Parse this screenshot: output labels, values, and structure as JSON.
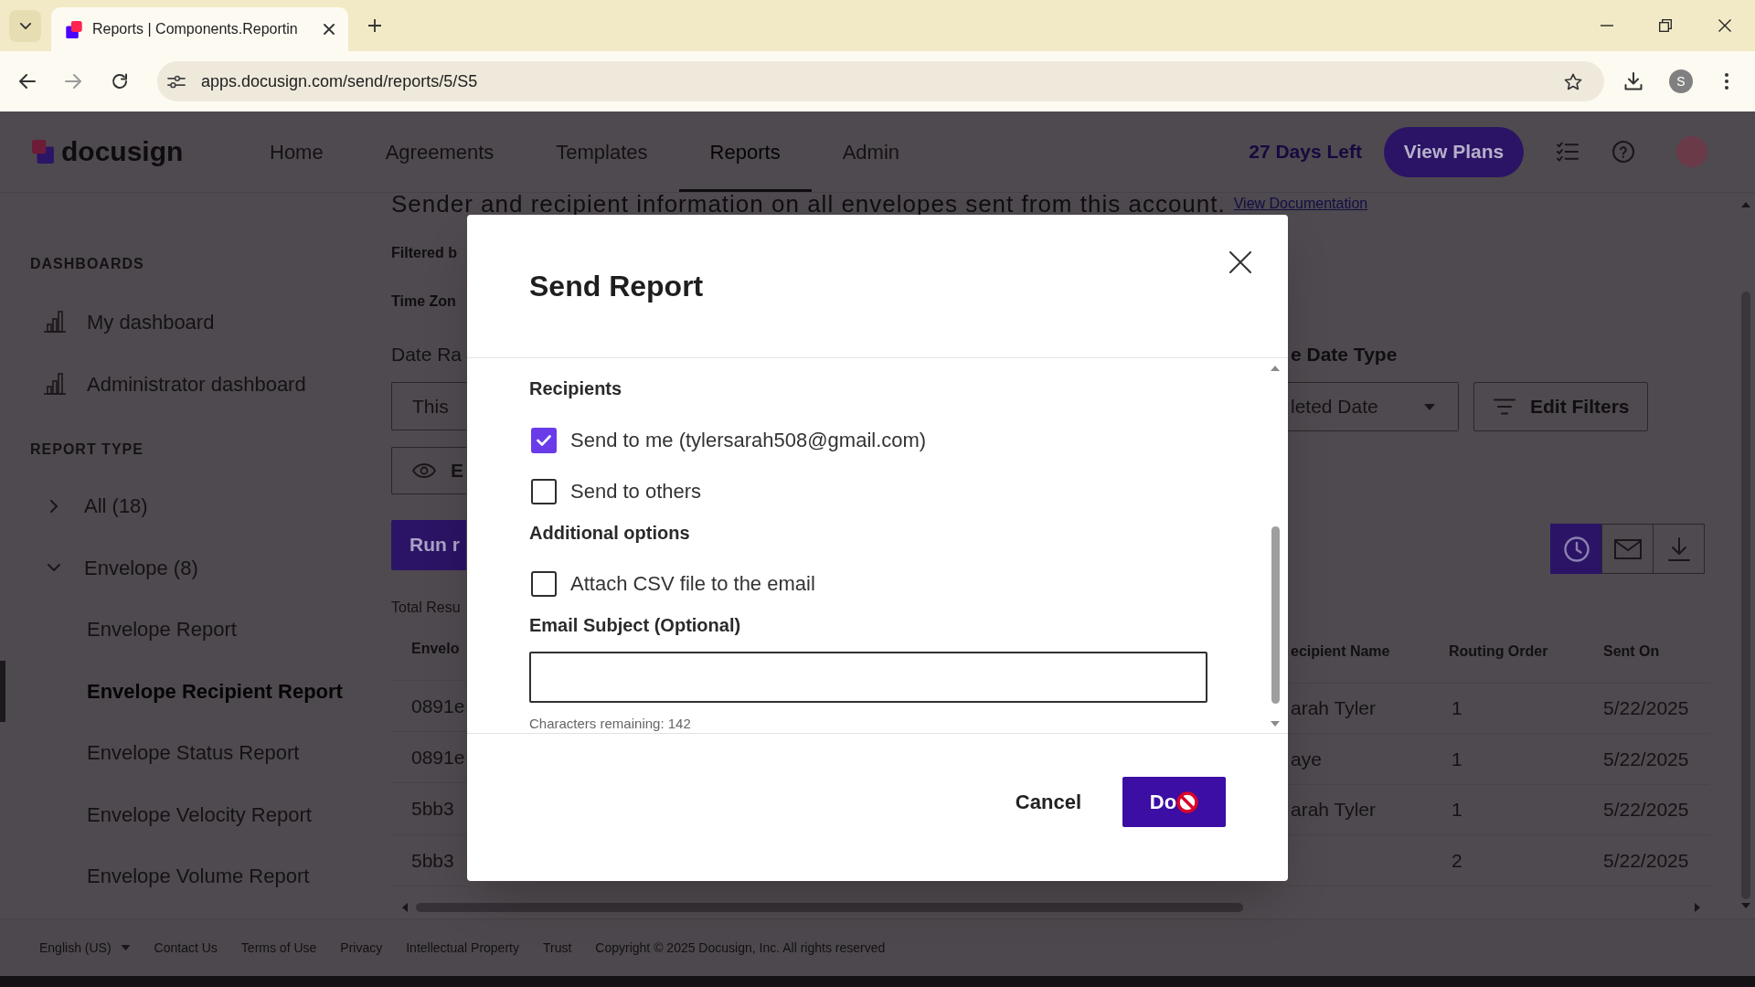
{
  "browser": {
    "tab_title": "Reports | Components.Reportin",
    "url": "apps.docusign.com/send/reports/5/S5",
    "profile_initial": "S"
  },
  "header": {
    "logo": "docusign",
    "nav": [
      {
        "label": "Home",
        "selected": false
      },
      {
        "label": "Agreements",
        "selected": false
      },
      {
        "label": "Templates",
        "selected": false
      },
      {
        "label": "Reports",
        "selected": true
      },
      {
        "label": "Admin",
        "selected": false
      }
    ],
    "trial": "27 Days Left",
    "cta": "View Plans"
  },
  "sidebar": {
    "dashboards_heading": "DASHBOARDS",
    "dashboards": [
      {
        "label": "My dashboard"
      },
      {
        "label": "Administrator dashboard"
      }
    ],
    "report_type_heading": "REPORT TYPE",
    "report_groups": [
      {
        "label": "All (18)",
        "expanded": false
      },
      {
        "label": "Envelope (8)",
        "expanded": true,
        "children": [
          {
            "label": "Envelope Report",
            "selected": false
          },
          {
            "label": "Envelope Recipient Report",
            "selected": true
          },
          {
            "label": "Envelope Status Report",
            "selected": false
          },
          {
            "label": "Envelope Velocity Report",
            "selected": false
          },
          {
            "label": "Envelope Volume Report",
            "selected": false
          }
        ]
      }
    ]
  },
  "report": {
    "description": "Sender and recipient information on all envelopes sent from this account.",
    "doc_link": "View Documentation",
    "filtered_label": "Filtered b",
    "time_zone_label": "Time Zon",
    "date_range_label": "Date Ra",
    "date_range_value": "This",
    "view_button": "E",
    "run_button": "Run r",
    "total_results": "Total Resu",
    "date_type_label": "e Date Type",
    "date_type_value": "leted Date",
    "edit_filters": "Edit Filters",
    "actions": [
      {
        "kind": "schedule",
        "selected": true
      },
      {
        "kind": "email",
        "selected": false
      },
      {
        "kind": "download",
        "selected": false
      }
    ]
  },
  "table": {
    "columns": [
      "Envelo",
      "ecipient Name",
      "Routing Order",
      "Sent On"
    ],
    "rows": [
      {
        "column_1": "0891e",
        "recipient_name": "arah Tyler",
        "routing_order": "1",
        "sent_on": "5/22/2025"
      },
      {
        "column_1": "0891e",
        "recipient_name": "aye",
        "routing_order": "1",
        "sent_on": "5/22/2025"
      },
      {
        "column_1": "5bb3",
        "recipient_name": "arah Tyler",
        "routing_order": "1",
        "sent_on": "5/22/2025"
      },
      {
        "column_1": "5bb3",
        "routing_order": "2",
        "sent_on": "5/22/2025"
      }
    ]
  },
  "footer": {
    "language": "English (US)",
    "links": [
      "Contact Us",
      "Terms of Use",
      "Privacy",
      "Intellectual Property",
      "Trust"
    ],
    "copyright": "Copyright © 2025 Docusign, Inc. All rights reserved"
  },
  "dialog": {
    "title": "Send Report",
    "recipients_heading": "Recipients",
    "recipients": [
      {
        "label": "Send to me (tylersarah508@gmail.com)",
        "checked": true
      },
      {
        "label": "Send to others",
        "checked": false
      }
    ],
    "options_heading": "Additional options",
    "options": [
      {
        "label": "Attach CSV file to the email",
        "checked": false
      }
    ],
    "subject_label": "Email Subject (Optional)",
    "counter": "Characters remaining: 142",
    "cancel": "Cancel",
    "done": "Do"
  }
}
